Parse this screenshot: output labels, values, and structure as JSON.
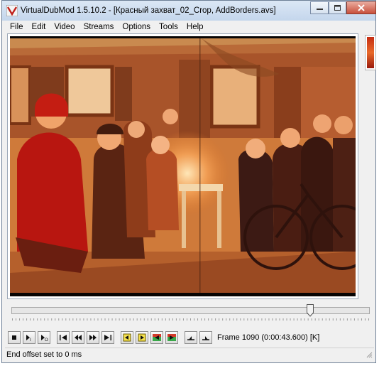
{
  "window": {
    "title": "VirtualDubMod 1.5.10.2 - [Красный захват_02_Crop, AddBorders.avs]",
    "minimize_icon": "minimize-icon",
    "maximize_icon": "maximize-icon",
    "close_icon": "close-icon"
  },
  "menu": [
    "File",
    "Edit",
    "Video",
    "Streams",
    "Options",
    "Tools",
    "Help"
  ],
  "video": {
    "description_icon": "video-frame"
  },
  "timeline": {
    "position": 0.84
  },
  "toolbar": {
    "frame_info": "Frame 1090 (0:00:43.600) [K]"
  },
  "status": {
    "text": "End offset set to 0 ms"
  }
}
